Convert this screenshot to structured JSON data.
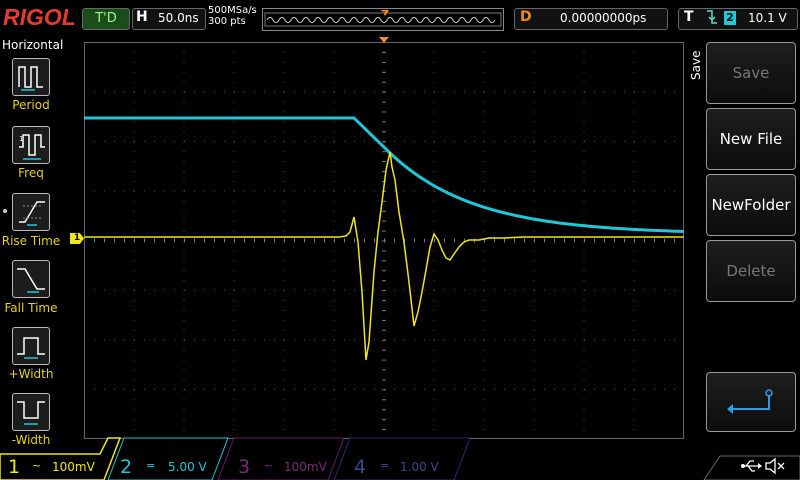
{
  "header": {
    "logo": "RIGOL",
    "trigger_status": "T'D",
    "horizontal_letter": "H",
    "timebase": "50.0ns",
    "sample_rate": "500MSa/s",
    "points": "300 pts",
    "delay_letter": "D",
    "delay_value": "0.00000000ps",
    "trigger_letter": "T",
    "trigger_source": "2",
    "trigger_level": "10.1 V"
  },
  "left_menu": {
    "title": "Horizontal",
    "items": [
      {
        "label": "Period",
        "icon": "period-icon"
      },
      {
        "label": "Freq",
        "icon": "freq-icon"
      },
      {
        "label": "Rise Time",
        "icon": "rise-time-icon"
      },
      {
        "label": "Fall Time",
        "icon": "fall-time-icon"
      },
      {
        "label": "+Width",
        "icon": "pos-width-icon"
      },
      {
        "label": "-Width",
        "icon": "neg-width-icon"
      }
    ]
  },
  "screen": {
    "ch1_marker": "1",
    "colors": {
      "ch1": "#f0e61c",
      "ch2": "#1ec8d8",
      "grid": "#444",
      "trigger": "#f08a1c"
    }
  },
  "right_menu": {
    "title": "Save",
    "buttons": [
      {
        "label": "Save",
        "enabled": false
      },
      {
        "label": "New File",
        "enabled": true
      },
      {
        "label": "NewFolder",
        "enabled": true
      },
      {
        "label": "Delete",
        "enabled": false
      }
    ],
    "enter_icon": "enter-icon"
  },
  "footer": {
    "channels": [
      {
        "num": "1",
        "scale": "100mV",
        "color": "#f0e61c"
      },
      {
        "num": "2",
        "scale": "5.00 V",
        "color": "#1ec8d8"
      },
      {
        "num": "3",
        "scale": "100mV",
        "color": "#c03cc0"
      },
      {
        "num": "4",
        "scale": "1.00 V",
        "color": "#3c5ae6"
      }
    ],
    "usb_icon": "usb-icon",
    "speaker_icon": "speaker-muted-icon"
  }
}
